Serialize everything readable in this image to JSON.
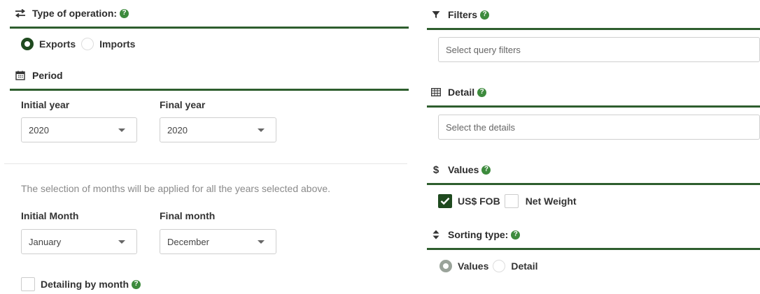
{
  "left": {
    "operation": {
      "title": "Type of operation:",
      "options": [
        "Exports",
        "Imports"
      ],
      "selected": "Exports"
    },
    "period": {
      "title": "Period",
      "initial_year_label": "Initial year",
      "final_year_label": "Final year",
      "initial_year_value": "2020",
      "final_year_value": "2020",
      "note": "The selection of months will be applied for all the years selected above.",
      "initial_month_label": "Initial Month",
      "final_month_label": "Final month",
      "initial_month_value": "January",
      "final_month_value": "December",
      "detailing_label": "Detailing by month"
    }
  },
  "right": {
    "filters": {
      "title": "Filters",
      "placeholder": "Select query filters"
    },
    "detail": {
      "title": "Detail",
      "placeholder": "Select the details"
    },
    "values": {
      "title": "Values",
      "options": [
        "US$ FOB",
        "Net Weight"
      ],
      "checked": [
        "US$ FOB"
      ]
    },
    "sorting": {
      "title": "Sorting type:",
      "options": [
        "Values",
        "Detail"
      ],
      "selected": "Values"
    }
  },
  "help_glyph": "?",
  "colors": {
    "rule": "#2e5e2e",
    "accent_dark": "#1f4a1f",
    "help_badge": "#3d8b3d"
  }
}
